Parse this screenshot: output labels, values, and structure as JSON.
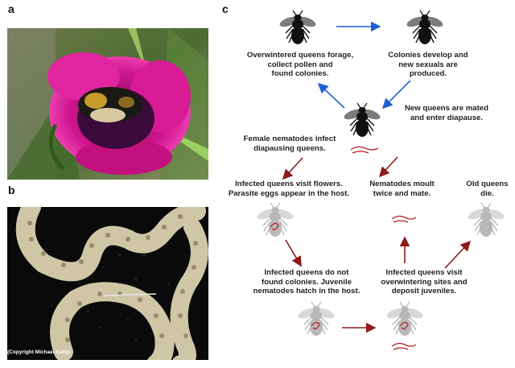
{
  "panels": {
    "a": "a",
    "b": "b",
    "c": "c"
  },
  "copyright": "(Copyright Michael Kelly)",
  "captions": {
    "overwintered": "Overwintered queens forage,\ncollect pollen and\nfound colonies.",
    "colonies": "Colonies develop and\nnew sexuals are\nproduced.",
    "mated": "New queens are mated\nand enter diapause.",
    "infect": "Female nematodes infect\ndiapausing queens.",
    "visit_flowers": "Infected queens visit flowers.\nParasite eggs appear in the host.",
    "moult": "Nematodes moult\ntwice and mate.",
    "old_queens": "Old queens\ndie.",
    "no_colonies": "Infected queens do not\nfound colonies. Juvenile\nnematodes hatch in the host.",
    "overwintering": "Infected queens visit\noverwintering sites and\ndeposit juveniles."
  },
  "colors": {
    "blue_arrow": "#1f5fd1",
    "red_arrow": "#8b1a1a",
    "bee_dark": "#111111",
    "bee_grey": "#bdbdbd",
    "nematode": "#b22222"
  }
}
